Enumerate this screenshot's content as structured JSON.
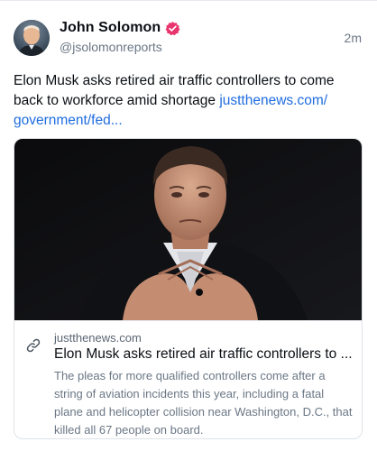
{
  "post": {
    "author": {
      "display_name": "John Solomon",
      "handle": "@jsolomonreports",
      "avatar_icon": "user-avatar",
      "verified_badge_color": "#e8356d"
    },
    "timestamp": "2m",
    "text": "Elon Musk asks retired air traffic controllers to come back to workforce amid shortage ",
    "link_text": "justthenews.com/\ngovernment/fed...",
    "link_color": "#1f6de0"
  },
  "card": {
    "image_alt": "Photo of Elon Musk with hands clasped",
    "link_icon": "link-icon",
    "domain": "justthenews.com",
    "title": "Elon Musk asks retired air traffic controllers to ...",
    "description": "The pleas for more qualified controllers come after a string of aviation incidents this year, including a fatal plane and helicopter collision near Washington, D.C., that killed all 67 people on board."
  }
}
